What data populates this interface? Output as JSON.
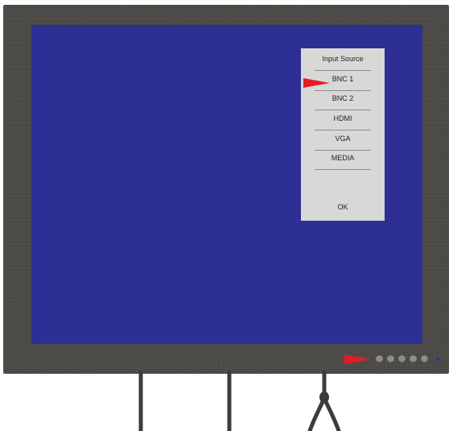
{
  "osd": {
    "title": "Input Source",
    "items": [
      "BNC 1",
      "BNC 2",
      "HDMI",
      "VGA",
      "MEDIA"
    ],
    "selected": "BNC 1",
    "ok_label": "OK"
  },
  "front_panel": {
    "button_count": 5,
    "power_led": "blue"
  },
  "colors": {
    "screen": "#2e2f94",
    "bezel": "#4b4946",
    "menu_background": "#d8d8d7",
    "pointer": "#e61c24"
  },
  "icons": [
    "selection-arrow-icon",
    "panel-arrow-icon",
    "power-led-icon"
  ]
}
